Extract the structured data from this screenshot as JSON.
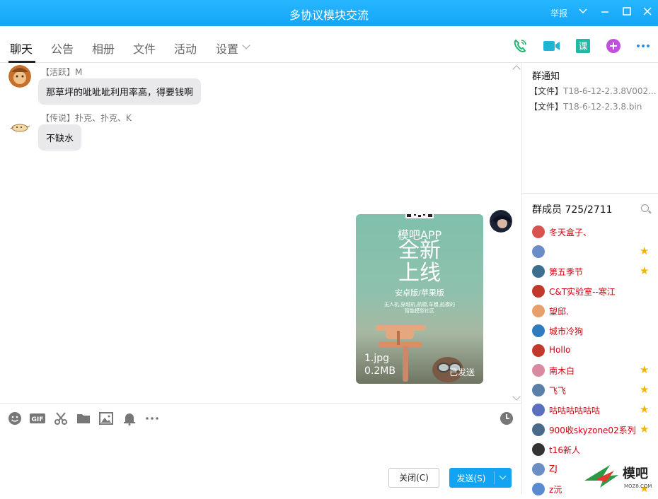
{
  "window": {
    "title": "多协议模块交流",
    "report_label": "举报"
  },
  "tabs": [
    {
      "label": "聊天",
      "active": true
    },
    {
      "label": "公告"
    },
    {
      "label": "相册"
    },
    {
      "label": "文件"
    },
    {
      "label": "活动"
    },
    {
      "label": "设置"
    }
  ],
  "toolbar_icons": [
    "phone-icon",
    "video-icon",
    "course-icon",
    "add-app-icon",
    "more-icon"
  ],
  "toolbar": {
    "course_label": "课"
  },
  "messages": [
    {
      "sender": "【活跃】M",
      "text": "那草坪的呲呲呲利用率高，得要钱啊"
    },
    {
      "sender": "【传说】扑克、扑克、K",
      "text": "不缺水"
    }
  ],
  "image_message": {
    "headline": "模吧APP",
    "big_text": "全新\n上线",
    "platforms": "安卓版/苹果版",
    "tagline": "无人机,穿越机,航模,车模,船模的\n智能模型社区",
    "file_name": "1.jpg",
    "file_size": "0.2MB",
    "status": "已发送"
  },
  "input_toolbar_icons": [
    "emoji-icon",
    "gif-icon",
    "scissors-icon",
    "folder-icon",
    "image-icon",
    "bell-icon",
    "more-icon",
    "history-clock-icon"
  ],
  "input_toolbar": {
    "gif_label": "GIF"
  },
  "buttons": {
    "close": "关闭(C)",
    "send": "发送(S)"
  },
  "group_notice": {
    "heading": "群通知",
    "files": [
      {
        "tag": "【文件】",
        "name": "T18-6-12-2.3.8V002..."
      },
      {
        "tag": "【文件】",
        "name": "T18-6-12-2.3.8.bin"
      }
    ]
  },
  "members": {
    "heading": "群成员 725/2711",
    "list": [
      {
        "name": "冬天盒子、",
        "star": false,
        "color": "#d8534f"
      },
      {
        "name": "",
        "star": true,
        "color": "#6a8cc8"
      },
      {
        "name": "第五季节",
        "star": true,
        "color": "#3d6e8f"
      },
      {
        "name": "C&T实验室--寒江",
        "star": false,
        "color": "#c0392b"
      },
      {
        "name": "望邱.",
        "star": false,
        "color": "#e8a06a"
      },
      {
        "name": "城市冷狗",
        "star": false,
        "color": "#2e7bbf"
      },
      {
        "name": "Hollo",
        "star": false,
        "color": "#c0392b"
      },
      {
        "name": "南木白",
        "star": true,
        "color": "#d98aa0"
      },
      {
        "name": "飞飞",
        "star": true,
        "color": "#5a7fa8"
      },
      {
        "name": "咕咕咕咕咕咕",
        "star": true,
        "color": "#5a6fbf"
      },
      {
        "name": "900收skyzone02系列",
        "star": true,
        "color": "#4a6a8a"
      },
      {
        "name": "t16新人",
        "star": false,
        "color": "#333333"
      },
      {
        "name": "ZJ",
        "star": false,
        "color": "#6b8ec5"
      },
      {
        "name": "z沅",
        "star": true,
        "color": "#5a8ad0"
      }
    ]
  },
  "watermark": {
    "brand": "模吧",
    "domain": "MOZ8.COM"
  },
  "colors": {
    "title_bar": "#1aabfa",
    "send_button": "#12a4f3",
    "member_name": "#d0000f",
    "star": "#f3b400"
  }
}
